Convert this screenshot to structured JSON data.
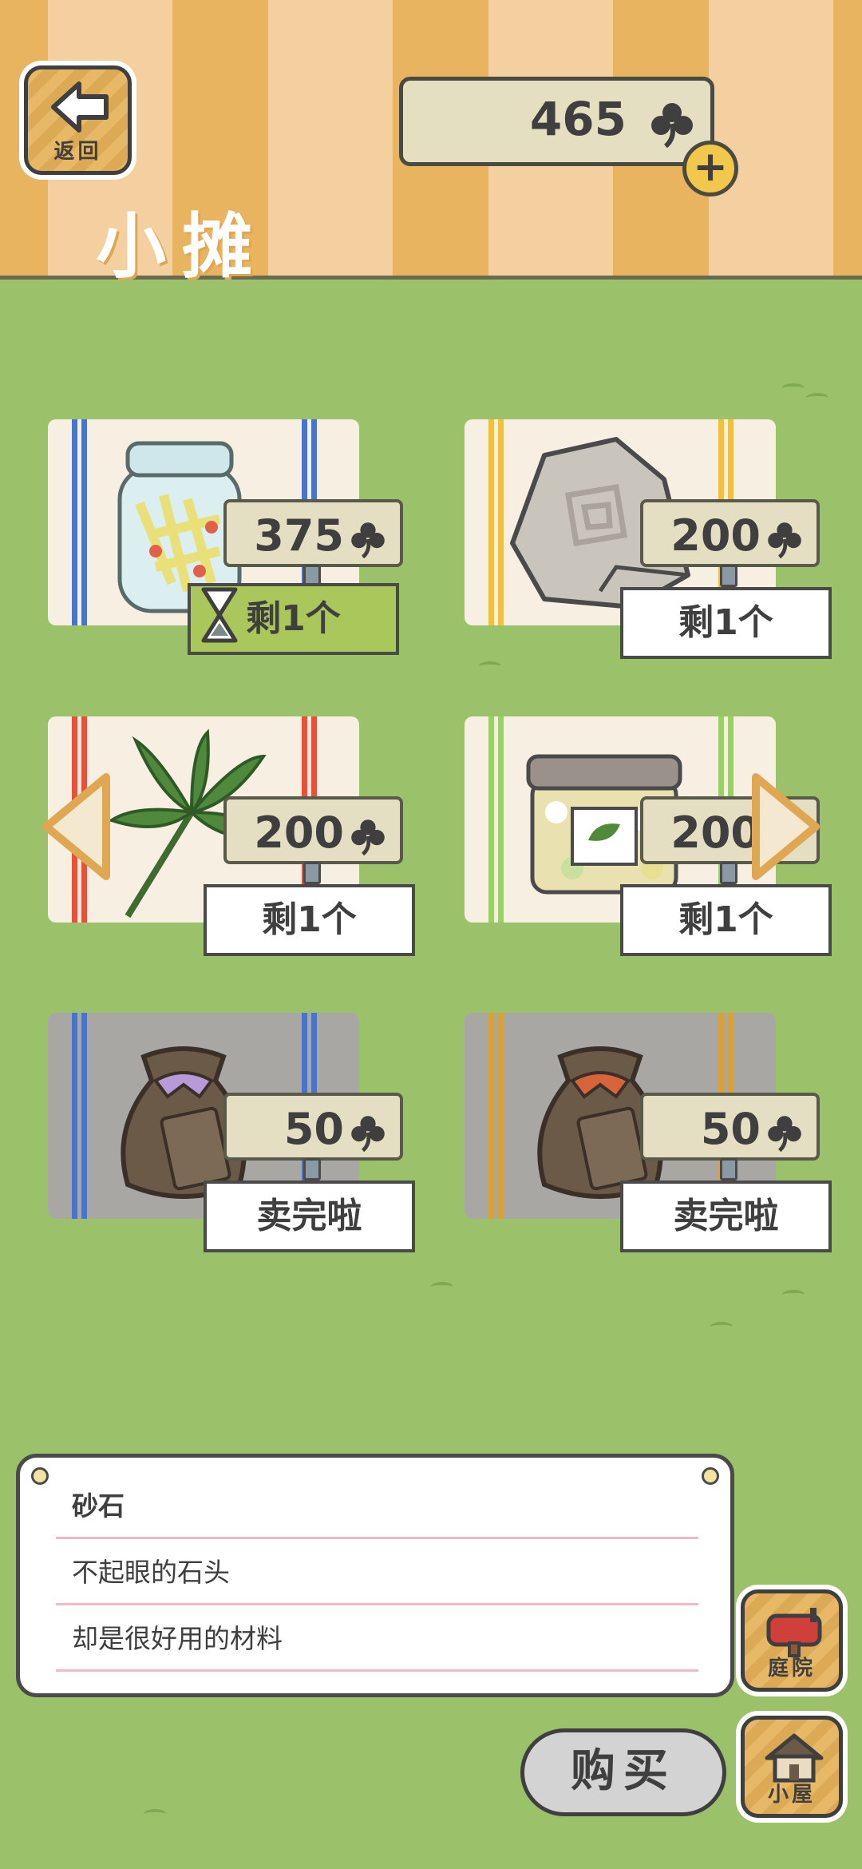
{
  "header": {
    "back_label": "返回",
    "title": "小摊",
    "clover_count": "465"
  },
  "items": [
    {
      "price": "375",
      "stock": "剩1个"
    },
    {
      "price": "200",
      "stock": "剩1个"
    },
    {
      "price": "200",
      "stock": "剩1个"
    },
    {
      "price": "200",
      "stock": "剩1个"
    },
    {
      "price": "50",
      "stock": "卖完啦"
    },
    {
      "price": "50",
      "stock": "卖完啦"
    }
  ],
  "description": {
    "name": "砂石",
    "line1": "不起眼的石头",
    "line2": "却是很好用的材料"
  },
  "buttons": {
    "garden_label": "庭院",
    "house_label": "小屋",
    "buy_label": "购买"
  },
  "icons": {
    "currency": "clover-icon",
    "back": "back-arrow-icon"
  }
}
